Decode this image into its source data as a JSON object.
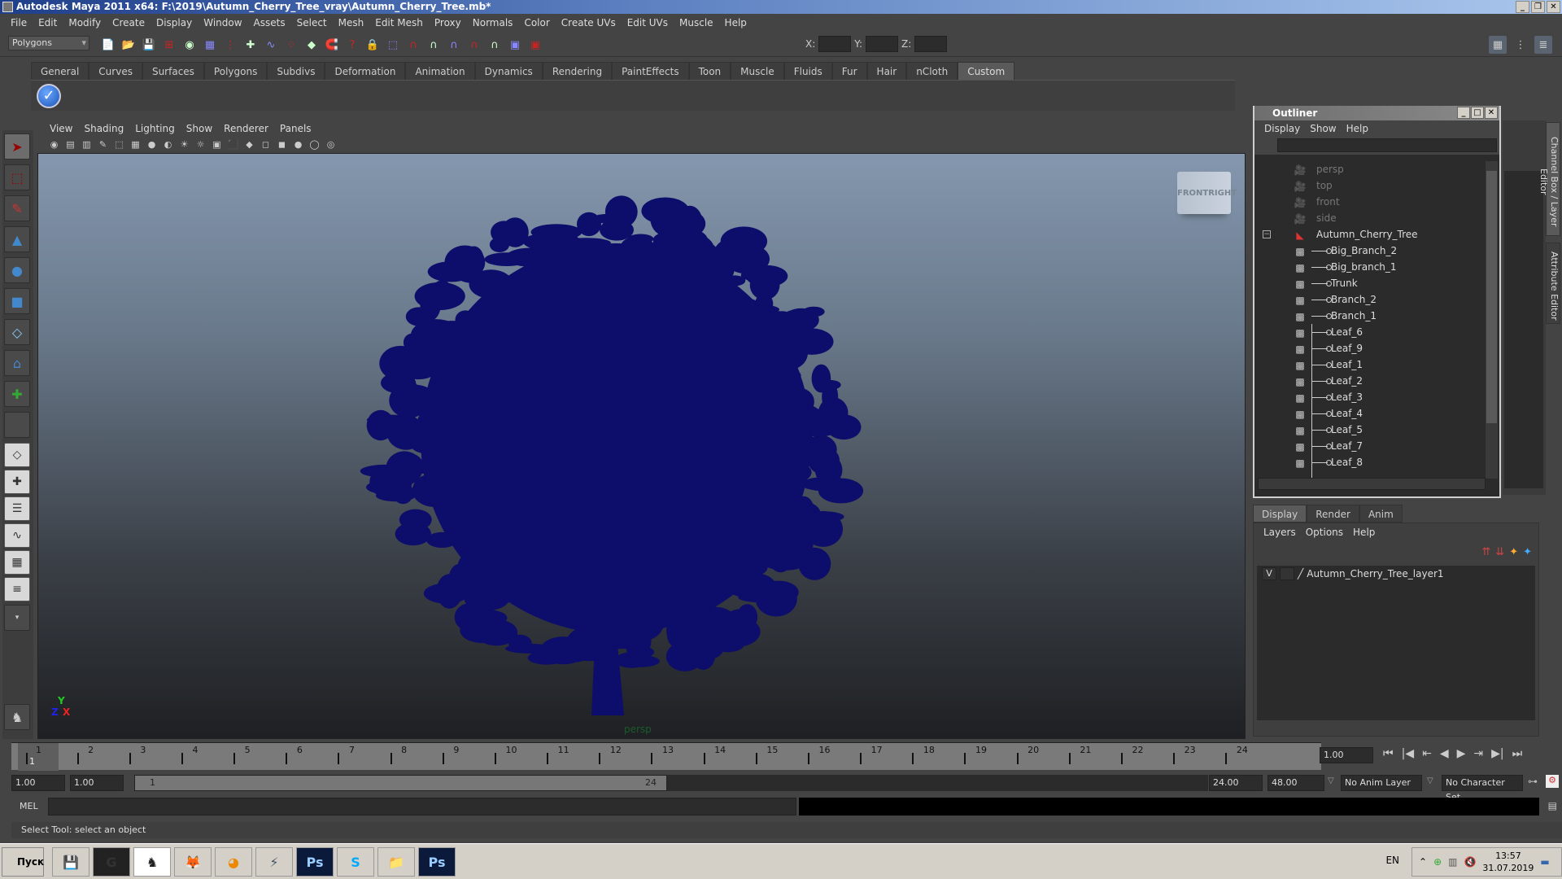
{
  "window": {
    "title": "Autodesk Maya 2011 x64: F:\\2019\\Autumn_Cherry_Tree_vray\\Autumn_Cherry_Tree.mb*",
    "controls": [
      "_",
      "❐",
      "✕"
    ]
  },
  "menubar": [
    "File",
    "Edit",
    "Modify",
    "Create",
    "Display",
    "Window",
    "Assets",
    "Select",
    "Mesh",
    "Edit Mesh",
    "Proxy",
    "Normals",
    "Color",
    "Create UVs",
    "Edit UVs",
    "Muscle",
    "Help"
  ],
  "toolbar": {
    "mode_select": "Polygons",
    "xyz_labels": {
      "x": "X:",
      "y": "Y:",
      "z": "Z:"
    }
  },
  "shelf": {
    "tabs": [
      "General",
      "Curves",
      "Surfaces",
      "Polygons",
      "Subdivs",
      "Deformation",
      "Animation",
      "Dynamics",
      "Rendering",
      "PaintEffects",
      "Toon",
      "Muscle",
      "Fluids",
      "Fur",
      "Hair",
      "nCloth",
      "Custom"
    ],
    "active_tab": "Custom",
    "items": [
      "checkmark-icon"
    ]
  },
  "viewport": {
    "menu": [
      "View",
      "Shading",
      "Lighting",
      "Show",
      "Renderer",
      "Panels"
    ],
    "camera_label": "persp",
    "viewcube": {
      "front": "FRONT",
      "right": "RIGHT"
    },
    "axis": {
      "x": "X",
      "y": "Y",
      "z": "Z"
    },
    "colors": {
      "mesh": "#0d0d6b",
      "bg_top": "#8497ae",
      "bg_bottom": "#1e2023"
    }
  },
  "outliner": {
    "title": "Outliner",
    "menu": [
      "Display",
      "Show",
      "Help"
    ],
    "items": [
      {
        "label": "persp",
        "type": "camera",
        "dim": true
      },
      {
        "label": "top",
        "type": "camera",
        "dim": true
      },
      {
        "label": "front",
        "type": "camera",
        "dim": true
      },
      {
        "label": "side",
        "type": "camera",
        "dim": true
      },
      {
        "label": "Autumn_Cherry_Tree",
        "type": "group",
        "expanded": true
      },
      {
        "label": "Big_Branch_2",
        "type": "mesh",
        "child": true
      },
      {
        "label": "Big_branch_1",
        "type": "mesh",
        "child": true
      },
      {
        "label": "Trunk",
        "type": "mesh",
        "child": true
      },
      {
        "label": "Branch_2",
        "type": "mesh",
        "child": true
      },
      {
        "label": "Branch_1",
        "type": "mesh",
        "child": true
      },
      {
        "label": "Leaf_6",
        "type": "mesh",
        "child": true
      },
      {
        "label": "Leaf_9",
        "type": "mesh",
        "child": true
      },
      {
        "label": "Leaf_1",
        "type": "mesh",
        "child": true
      },
      {
        "label": "Leaf_2",
        "type": "mesh",
        "child": true
      },
      {
        "label": "Leaf_3",
        "type": "mesh",
        "child": true
      },
      {
        "label": "Leaf_4",
        "type": "mesh",
        "child": true
      },
      {
        "label": "Leaf_5",
        "type": "mesh",
        "child": true
      },
      {
        "label": "Leaf_7",
        "type": "mesh",
        "child": true
      },
      {
        "label": "Leaf_8",
        "type": "mesh",
        "child": true
      }
    ]
  },
  "side_tabs": [
    "Channel Box / Layer Editor",
    "Attribute Editor"
  ],
  "layer_editor": {
    "tabs": [
      "Display",
      "Render",
      "Anim"
    ],
    "active_tab": "Display",
    "menu": [
      "Layers",
      "Options",
      "Help"
    ],
    "layers": [
      {
        "visible": "V",
        "name": "Autumn_Cherry_Tree_layer1"
      }
    ]
  },
  "timeline": {
    "ticks": [
      "1",
      "2",
      "3",
      "4",
      "5",
      "6",
      "7",
      "8",
      "9",
      "10",
      "11",
      "12",
      "13",
      "14",
      "15",
      "16",
      "17",
      "18",
      "19",
      "20",
      "21",
      "22",
      "23",
      "24"
    ],
    "current_frame_marker": "1",
    "current_frame": "1.00"
  },
  "range": {
    "start": "1.00",
    "playback_start": "1.00",
    "slider_start": "1",
    "slider_end": "24",
    "playback_end": "24.00",
    "end": "48.00",
    "anim_layer": "No Anim Layer",
    "character_set": "No Character Set"
  },
  "command_line": {
    "label": "MEL",
    "value": ""
  },
  "help_line": "Select Tool: select an object",
  "taskbar": {
    "start": "Пуск",
    "apps": [
      "save-app",
      "3dsmax",
      "maya",
      "firefox",
      "blender",
      "corel",
      "photoshop",
      "skype",
      "explorer",
      "photoshop-2"
    ],
    "language": "EN",
    "time": "13:57",
    "date": "31.07.2019"
  }
}
